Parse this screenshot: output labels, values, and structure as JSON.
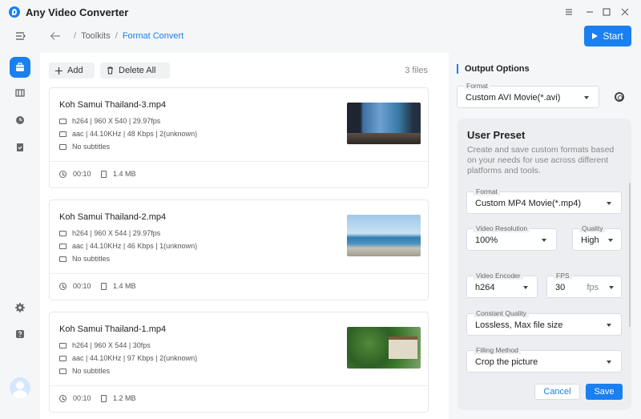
{
  "app": {
    "title": "Any Video Converter"
  },
  "window": {
    "menu_icon": "menu-icon",
    "minimize_icon": "minimize-icon",
    "maximize_icon": "maximize-icon",
    "close_icon": "close-icon"
  },
  "breadcrumb": {
    "root": "Toolkits",
    "separator": "/",
    "current": "Format Convert"
  },
  "header": {
    "start_label": "Start"
  },
  "rail": {
    "items": [
      "toolkit-icon",
      "library-icon",
      "history-icon",
      "tasks-icon"
    ],
    "bottom": [
      "settings-icon",
      "help-icon"
    ]
  },
  "toolbar": {
    "add_label": "Add",
    "delete_all_label": "Delete All",
    "file_count": "3 files"
  },
  "files": [
    {
      "name": "Koh Samui Thailand-3.mp4",
      "video": "h264 | 960 X 540 | 29.97fps",
      "audio": "aac | 44.10KHz | 48 Kbps | 2(unknown)",
      "subtitles": "No subtitles",
      "duration": "00:10",
      "size": "1.4 MB"
    },
    {
      "name": "Koh Samui Thailand-2.mp4",
      "video": "h264 | 960 X 544 | 29.97fps",
      "audio": "aac | 44.10KHz | 46 Kbps | 1(unknown)",
      "subtitles": "No subtitles",
      "duration": "00:10",
      "size": "1.4 MB"
    },
    {
      "name": "Koh Samui Thailand-1.mp4",
      "video": "h264 | 960 X 544 | 30fps",
      "audio": "aac | 44.10KHz | 97 Kbps | 2(unknown)",
      "subtitles": "No subtitles",
      "duration": "00:10",
      "size": "1.2 MB"
    }
  ],
  "output": {
    "heading": "Output Options",
    "format_label": "Format",
    "format_value": "Custom AVI Movie(*.avi)"
  },
  "preset": {
    "title": "User Preset",
    "description": "Create and save custom formats based on your needs for use across different platforms and tools.",
    "format_label": "Format",
    "format_value": "Custom MP4 Movie(*.mp4)",
    "resolution_label": "Video Resolution",
    "resolution_value": "100%",
    "quality_label": "Quality",
    "quality_value": "High",
    "encoder_label": "Video Encoder",
    "encoder_value": "h264",
    "fps_label": "FPS",
    "fps_value": "30",
    "fps_unit": "fps",
    "constant_quality_label": "Constant Quality",
    "constant_quality_value": "Lossless, Max file size",
    "filling_label": "Filling Method",
    "filling_value": "Crop the picture",
    "cancel_label": "Cancel",
    "save_label": "Save"
  },
  "colors": {
    "accent": "#1a7ff0"
  }
}
